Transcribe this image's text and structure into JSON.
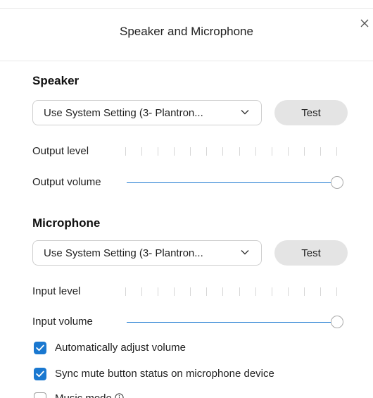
{
  "dialog": {
    "title": "Speaker and Microphone"
  },
  "speaker": {
    "section_title": "Speaker",
    "device_select": "Use System Setting (3- Plantron...",
    "test_label": "Test",
    "output_level_label": "Output level",
    "output_level_value": 0,
    "output_volume_label": "Output volume",
    "output_volume_value": 1.0
  },
  "microphone": {
    "section_title": "Microphone",
    "device_select": "Use System Setting (3- Plantron...",
    "test_label": "Test",
    "input_level_label": "Input level",
    "input_level_value": 0,
    "input_volume_label": "Input volume",
    "input_volume_value": 1.0
  },
  "options": [
    {
      "label": "Automatically adjust volume",
      "checked": true
    },
    {
      "label": "Sync mute button status on microphone device",
      "checked": true
    },
    {
      "label": "Music mode",
      "checked": false,
      "info_icon": "info-circle-icon"
    }
  ],
  "colors": {
    "accent": "#1a78d0",
    "button_bg": "#e4e4e4"
  }
}
